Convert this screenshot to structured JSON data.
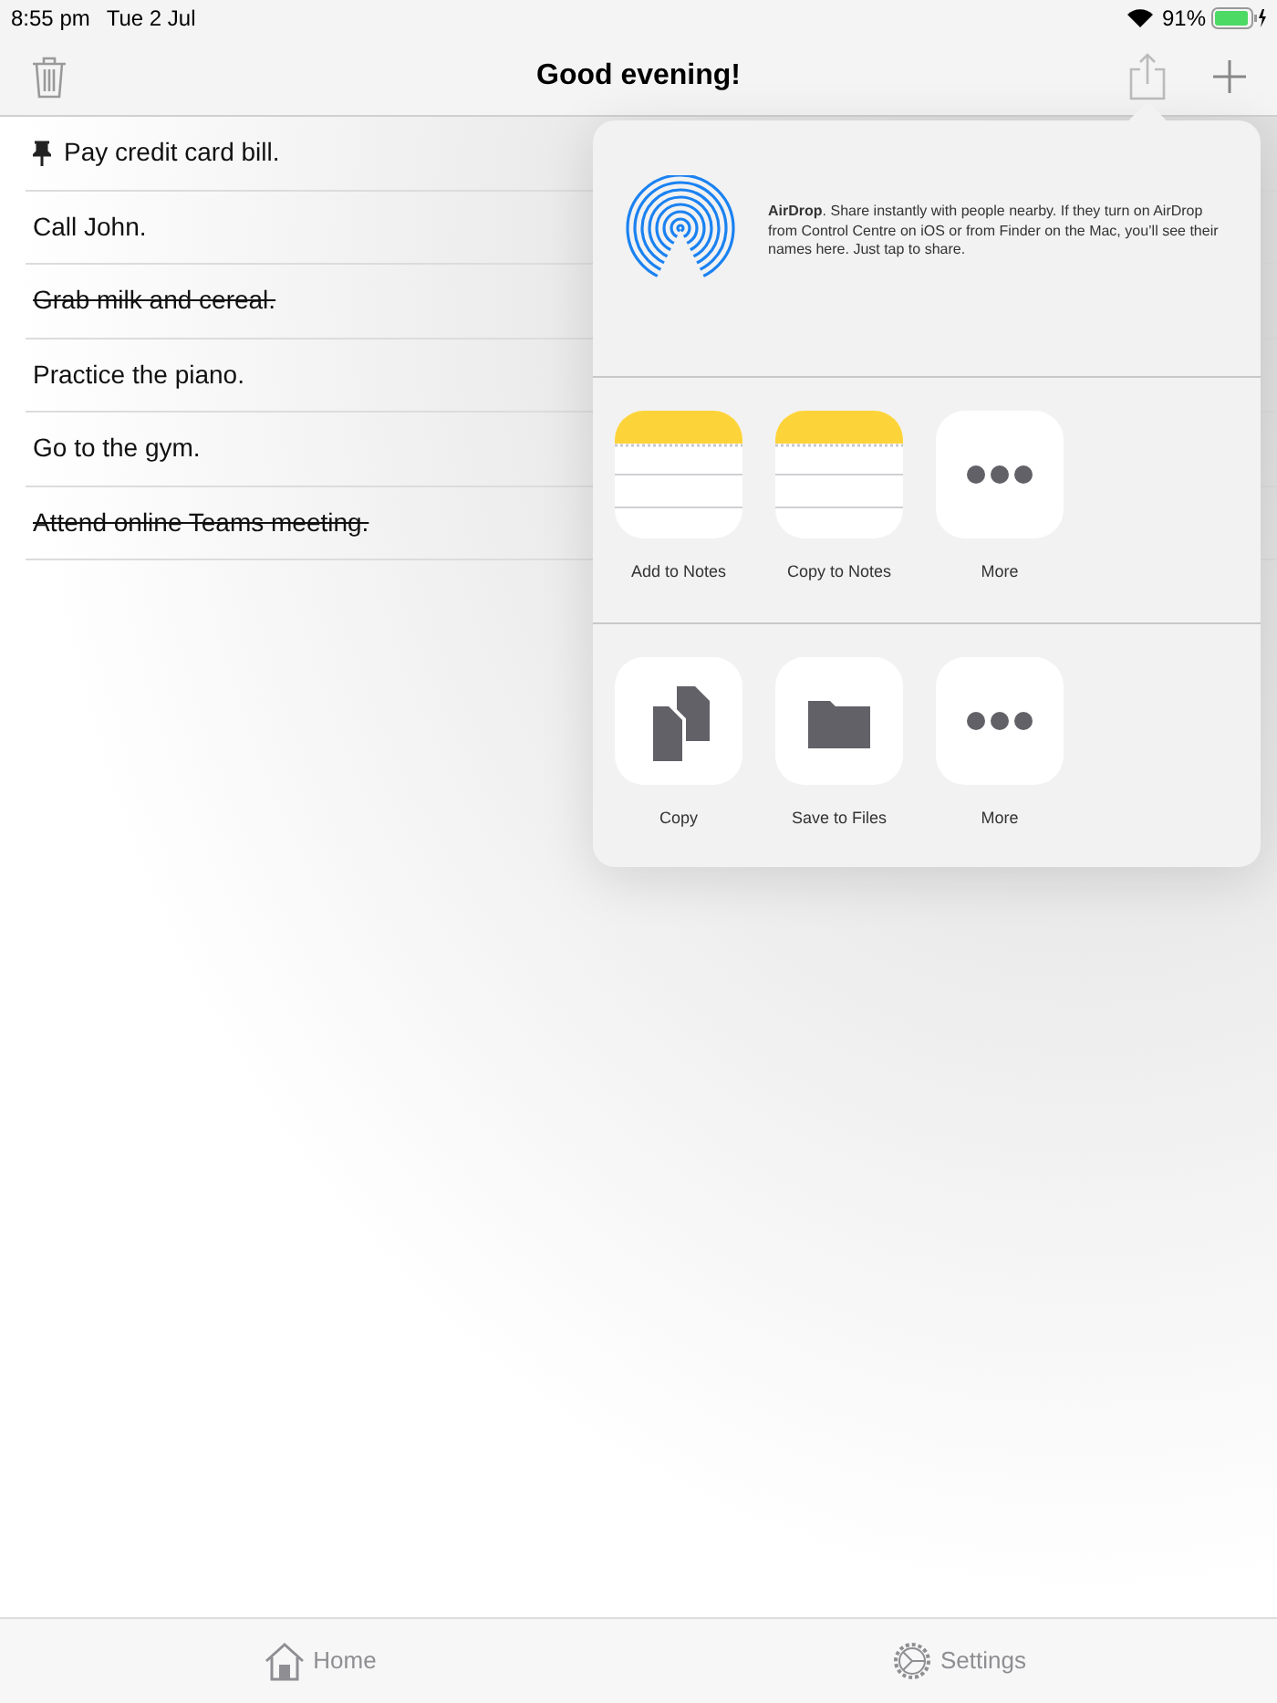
{
  "status_bar": {
    "time": "8:55 pm",
    "date": "Tue 2 Jul",
    "battery": "91%"
  },
  "nav_bar": {
    "title": "Good evening!"
  },
  "tasks": [
    {
      "text": "Pay credit card bill.",
      "pinned": true,
      "done": false
    },
    {
      "text": "Call John.",
      "pinned": false,
      "done": false
    },
    {
      "text": "Grab milk and cereal.",
      "pinned": false,
      "done": true
    },
    {
      "text": "Practice the piano.",
      "pinned": false,
      "done": false
    },
    {
      "text": "Go to the gym.",
      "pinned": false,
      "done": false
    },
    {
      "text": "Attend online Teams meeting.",
      "pinned": false,
      "done": true
    }
  ],
  "share_sheet": {
    "airdrop_text": "**AirDrop**. Share instantly with people nearby. If they turn on AirDrop from Control Centre on iOS or from Finder on the Mac, you’ll see their names here. Just tap to share.",
    "app_row": [
      {
        "kind": "notes",
        "label": "Add to Notes"
      },
      {
        "kind": "notes",
        "label": "Copy to Notes"
      },
      {
        "kind": "more",
        "label": "More"
      }
    ],
    "action_row": [
      {
        "kind": "copy",
        "label": "Copy"
      },
      {
        "kind": "files",
        "label": "Save to Files"
      },
      {
        "kind": "more",
        "label": "More"
      }
    ]
  },
  "tab_bar": [
    {
      "kind": "home",
      "label": "Home"
    },
    {
      "kind": "settings",
      "label": "Settings"
    }
  ]
}
